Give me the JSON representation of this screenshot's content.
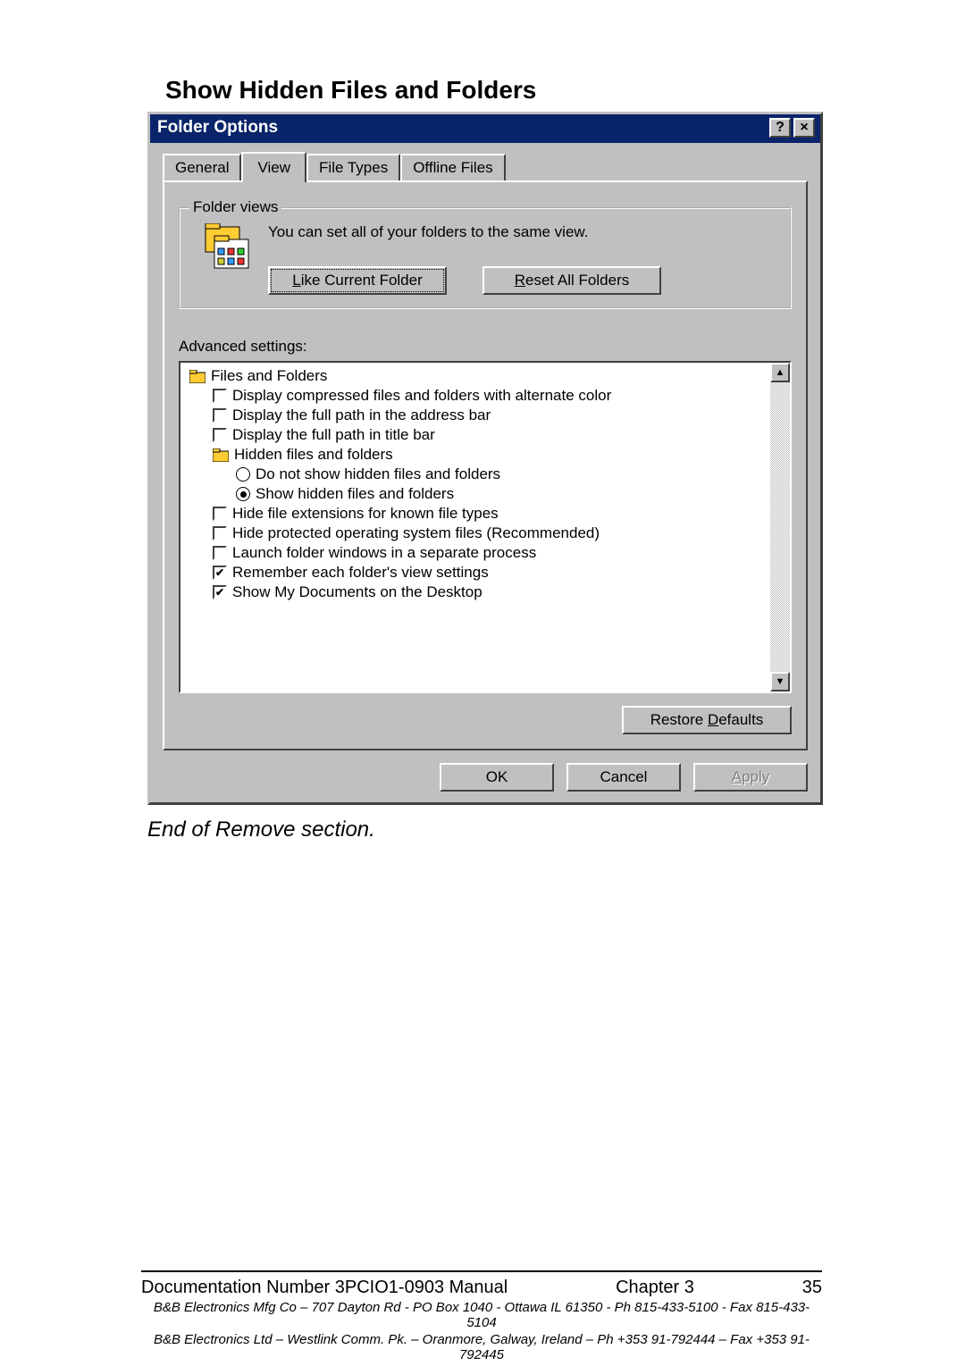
{
  "section_title": "Show Hidden Files and Folders",
  "dialog": {
    "title": "Folder Options",
    "tabs": [
      "General",
      "View",
      "File Types",
      "Offline Files"
    ],
    "active_tab_index": 1,
    "folder_views": {
      "group_label": "Folder views",
      "description": "You can set all of your folders to the same view.",
      "like_button": "Like Current Folder",
      "reset_button": "Reset All Folders"
    },
    "advanced_label": "Advanced settings:",
    "tree": {
      "root": "Files and Folders",
      "items": [
        {
          "type": "checkbox",
          "checked": false,
          "label": "Display compressed files and folders with alternate color"
        },
        {
          "type": "checkbox",
          "checked": false,
          "label": "Display the full path in the address bar"
        },
        {
          "type": "checkbox",
          "checked": false,
          "label": "Display the full path in title bar"
        },
        {
          "type": "folder",
          "label": "Hidden files and folders"
        },
        {
          "type": "radio",
          "checked": false,
          "label": "Do not show hidden files and folders",
          "indent": 3
        },
        {
          "type": "radio",
          "checked": true,
          "label": "Show hidden files and folders",
          "indent": 3
        },
        {
          "type": "checkbox",
          "checked": false,
          "label": "Hide file extensions for known file types"
        },
        {
          "type": "checkbox",
          "checked": false,
          "label": "Hide protected operating system files (Recommended)"
        },
        {
          "type": "checkbox",
          "checked": false,
          "label": "Launch folder windows in a separate process"
        },
        {
          "type": "checkbox",
          "checked": true,
          "label": "Remember each folder's view settings"
        },
        {
          "type": "checkbox",
          "checked": true,
          "label": "Show My Documents on the Desktop"
        }
      ]
    },
    "restore_button": "Restore Defaults",
    "ok_button": "OK",
    "cancel_button": "Cancel",
    "apply_button": "Apply"
  },
  "end_note": "End of Remove section.",
  "footer": {
    "left": "Documentation Number 3PCIO1-0903 Manual",
    "center": "Chapter 3",
    "right": "35",
    "line1": "B&B Electronics Mfg Co – 707 Dayton Rd - PO Box 1040 - Ottawa IL 61350 - Ph 815-433-5100 - Fax 815-433-5104",
    "line2": "B&B Electronics Ltd – Westlink Comm. Pk. – Oranmore, Galway, Ireland – Ph +353 91-792444 – Fax +353 91-792445"
  }
}
